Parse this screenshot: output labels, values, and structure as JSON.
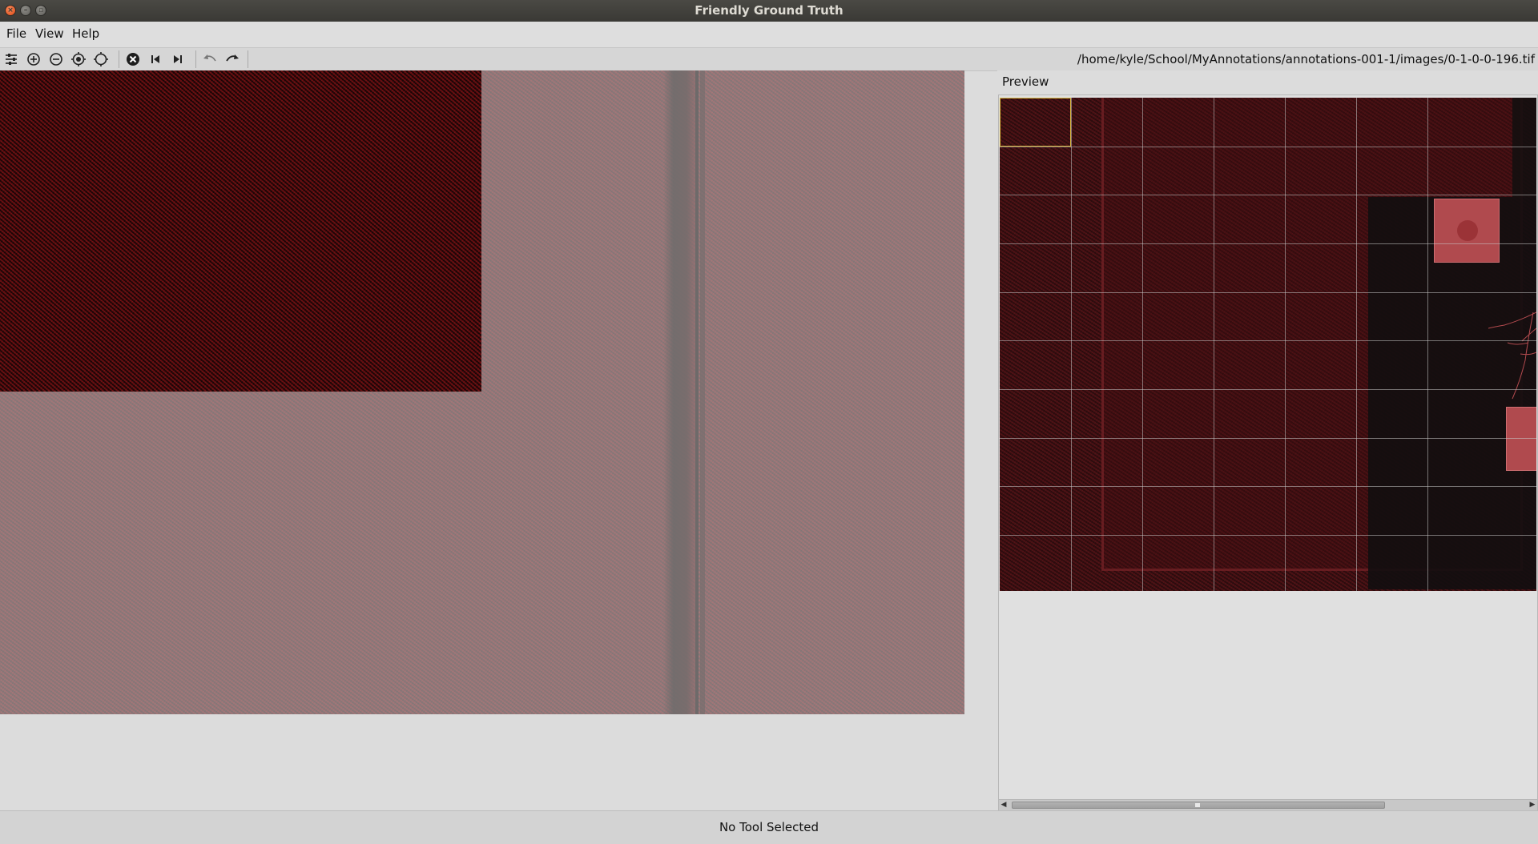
{
  "window": {
    "title": "Friendly Ground Truth",
    "close_icon": "close-icon",
    "minimize_icon": "minimize-icon",
    "maximize_icon": "maximize-icon"
  },
  "menubar": {
    "items": [
      {
        "label": "File"
      },
      {
        "label": "View"
      },
      {
        "label": "Help"
      }
    ]
  },
  "toolbar": {
    "buttons": [
      {
        "icon": "sliders-icon"
      },
      {
        "icon": "zoom-in-icon"
      },
      {
        "icon": "zoom-out-icon"
      },
      {
        "icon": "target-filled-icon"
      },
      {
        "icon": "target-outline-icon"
      },
      {
        "icon": "cancel-circle-icon"
      },
      {
        "icon": "previous-image-icon"
      },
      {
        "icon": "next-image-icon"
      },
      {
        "icon": "undo-icon"
      },
      {
        "icon": "redo-icon"
      }
    ],
    "file_path": "/home/kyle/School/MyAnnotations/annotations-001-1/images/0-1-0-0-196.tif"
  },
  "preview": {
    "title": "Preview",
    "grid": {
      "columns": 7,
      "rows": 10,
      "selected_cell": [
        0,
        0
      ]
    }
  },
  "colors": {
    "image_red": "#8b1a1d",
    "selection_yellow": "#d8b840",
    "title_bar": "#3d3c38"
  },
  "statusbar": {
    "text": "No Tool Selected"
  }
}
